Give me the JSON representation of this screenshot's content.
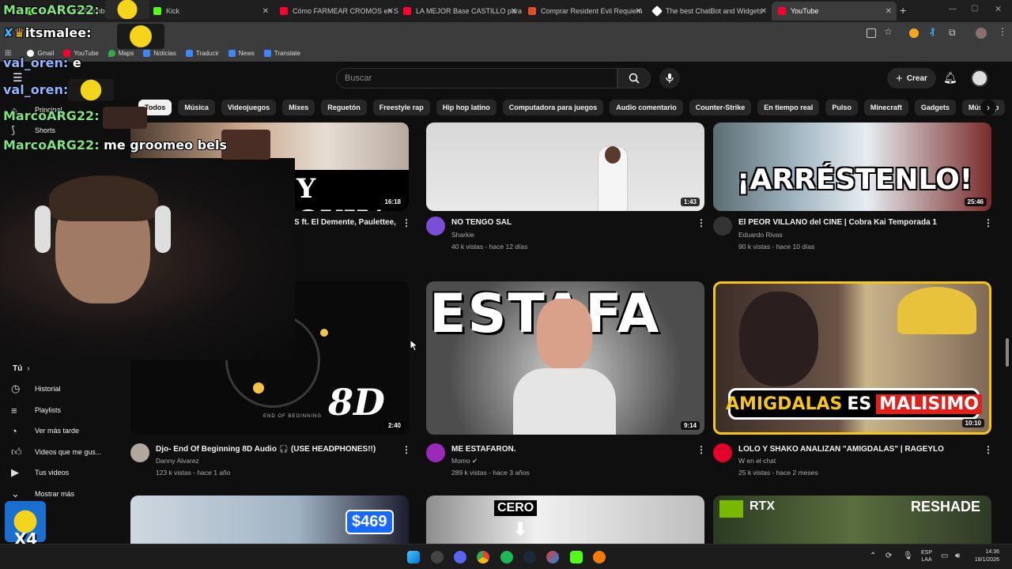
{
  "browser": {
    "tabs": [
      {
        "title": "Stream - Kick Dashboard",
        "color": "#53fc18"
      },
      {
        "title": "Kick",
        "color": "#53fc18"
      },
      {
        "title": "Cómo FARMEAR CROMOS en S",
        "color": "#ff0033"
      },
      {
        "title": "LA MEJOR Base CASTILLO para",
        "color": "#ff0033"
      },
      {
        "title": "Comprar Resident Evil Requiem",
        "color": "#e34c26"
      },
      {
        "title": "The best ChatBot and Widgets",
        "color": "#ffffff"
      },
      {
        "title": "YouTube",
        "color": "#ff0033"
      }
    ],
    "bookmarks": [
      "Gmail",
      "YouTube",
      "Maps",
      "Noticias",
      "Traducir",
      "News",
      "Translate"
    ]
  },
  "youtube": {
    "search_placeholder": "Buscar",
    "create_label": "Crear",
    "chips": [
      "Todos",
      "Música",
      "Videojuegos",
      "Mixes",
      "Reguetón",
      "Freestyle rap",
      "Hip hop latino",
      "Computadora para juegos",
      "Audio comentario",
      "Counter-Strike",
      "En tiempo real",
      "Pulso",
      "Minecraft",
      "Gadgets",
      "Música p"
    ],
    "sidebar": {
      "principal": "Principal",
      "shorts": "Shorts",
      "tu": "Tú",
      "items": [
        "Historial",
        "Playlists",
        "Ver más tarde",
        "Videos que me gus...",
        "Tus videos",
        "Mostrar más"
      ]
    },
    "videos": [
      {
        "title": "S ft. El Demente, Paulettee,",
        "channel": "",
        "meta": "",
        "duration": "16:18",
        "thumb_text": "Y OUIJA"
      },
      {
        "title": "NO TENGO SAL",
        "channel": "Sharkie",
        "meta": "40 k vistas - hace 12 días",
        "duration": "1:43"
      },
      {
        "title": "El PEOR VILLANO del CINE | Cobra Kai Temporada 1",
        "channel": "Eduardo Rivas",
        "meta": "90 k vistas - hace 10 días",
        "duration": "25:46",
        "thumb_text": "¡ARRÉSTENLO!"
      },
      {
        "title": "Djo- End Of Beginning 8D Audio 🎧 (USE HEADPHONES!!)",
        "channel": "Danny Alvarez",
        "meta": "123 k vistas - hace 1 año",
        "duration": "2:40",
        "thumb_text": "8D",
        "thumb_small": "END OF BEGINNING"
      },
      {
        "title": "ME ESTAFARON.",
        "channel": "Momo",
        "meta": "289 k vistas - hace 3 años",
        "duration": "9:14",
        "thumb_text": "ESTAFA"
      },
      {
        "title": "LOLO Y SHAKO ANALIZAN \"AMIGDALAS\" | RAGEYLO",
        "channel": "W en el chat",
        "meta": "25 k vistas - hace 2 meses",
        "duration": "10:10",
        "thumb_text_a": "AMIGDALAS",
        "thumb_text_b": "ES",
        "thumb_text_c": "MALISIMO"
      },
      {
        "thumb_text": "$469"
      },
      {
        "thumb_text": "CERO"
      },
      {
        "thumb_text_a": "RTX",
        "thumb_text_b": "RESHADE"
      }
    ]
  },
  "overlay": {
    "chat": [
      {
        "user": "MarcoARG22:",
        "msg": ""
      },
      {
        "user": "itsmalee:",
        "msg": ""
      },
      {
        "user": "val_oren:",
        "msg": "e"
      },
      {
        "user": "val_oren:",
        "msg": ""
      },
      {
        "user": "MarcoARG22:",
        "msg": ""
      },
      {
        "user": "MarcoARG22:",
        "msg": "me groomeo bels"
      }
    ],
    "badge": "X4"
  },
  "taskbar": {
    "lang": "ESP",
    "lang2": "LAA",
    "time": "14:36",
    "date": "18/1/2026"
  }
}
